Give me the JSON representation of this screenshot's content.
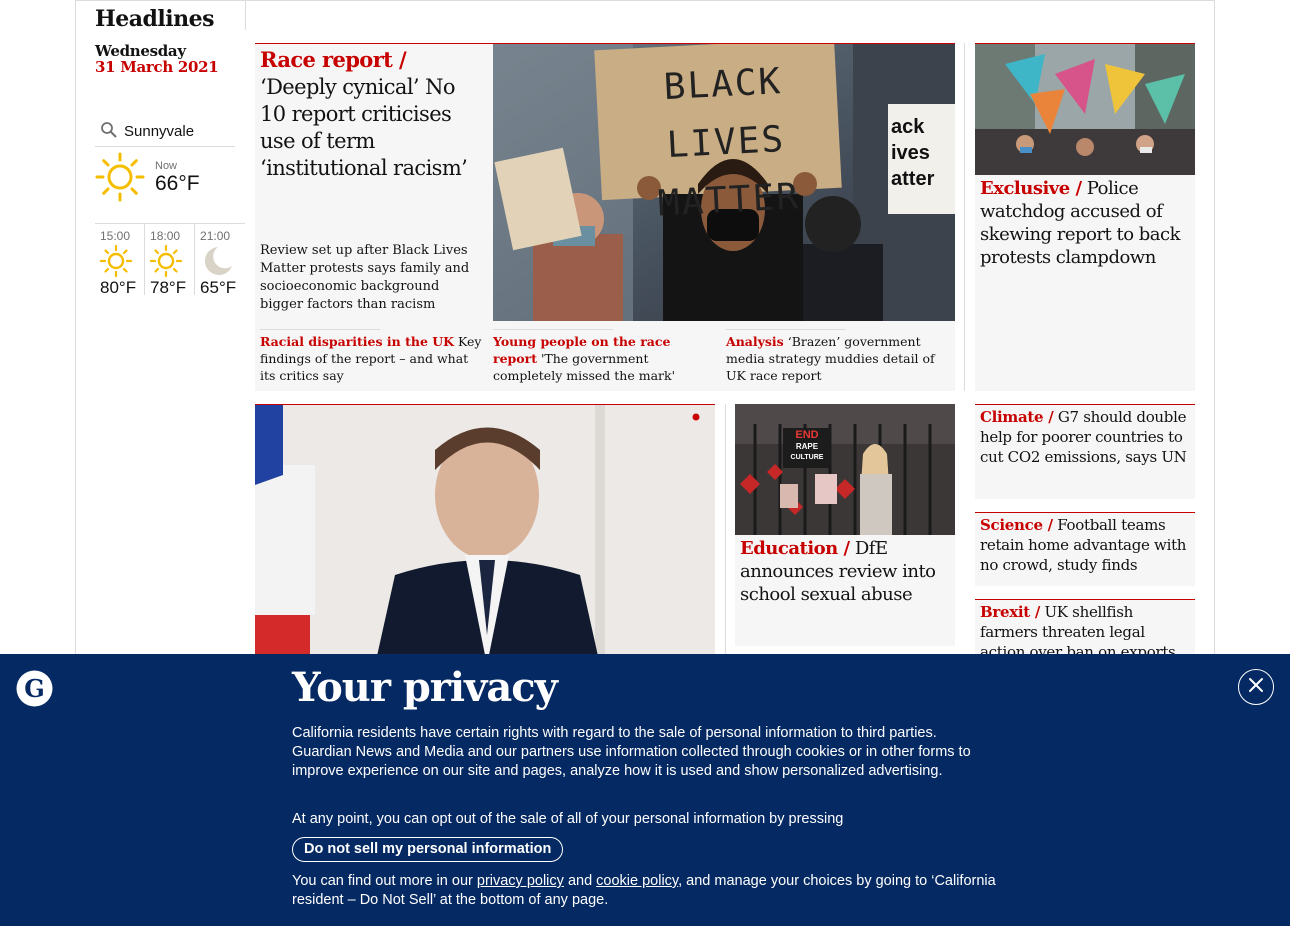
{
  "sidebar": {
    "section_title": "Headlines",
    "day": "Wednesday",
    "date": "31 March 2021",
    "weather": {
      "location": "Sunnyvale",
      "now_label": "Now",
      "now_temp": "66°F",
      "now_icon": "sun-icon",
      "forecast": [
        {
          "time": "15:00",
          "temp": "80°F",
          "icon": "sun-icon"
        },
        {
          "time": "18:00",
          "temp": "78°F",
          "icon": "sun-icon"
        },
        {
          "time": "21:00",
          "temp": "65°F",
          "icon": "moon-icon"
        }
      ]
    }
  },
  "lead": {
    "kicker": "Race report /",
    "headline": "‘Deeply cynical’ No 10 report criticises use of term ‘institutional racism’",
    "standfirst": "Review set up after Black Lives Matter protests says family and socioeconomic background bigger factors than racism",
    "image_sign_text": [
      "BLACK LIVES",
      "MATTER"
    ],
    "image_sign2_text": [
      "ack",
      "ives",
      "atter"
    ],
    "sublinks": [
      {
        "kicker": "Racial disparities in the UK",
        "text": "Key findings of the report – and what its critics say"
      },
      {
        "kicker": "Young people on the race report",
        "text": "'The government completely missed the mark'"
      },
      {
        "kicker": "Analysis",
        "text": "‘Brazen’ government media strategy muddies detail of UK race report"
      }
    ]
  },
  "side_top": {
    "kicker": "Exclusive /",
    "headline": "Police watchdog accused of skewing report to back protests clampdown"
  },
  "education": {
    "kicker": "Education /",
    "headline": "DfE announces review into school sexual abuse",
    "image_sign_text": [
      "END",
      "RAPE",
      "CULTURE"
    ]
  },
  "small_stories": [
    {
      "kicker": "Climate /",
      "headline": "G7 should double help for poorer countries to cut CO2 emissions, says UN"
    },
    {
      "kicker": "Science /",
      "headline": "Football teams retain home advantage with no crowd, study finds"
    },
    {
      "kicker": "Brexit /",
      "headline": "UK shellfish farmers threaten legal action over ban on exports"
    }
  ],
  "privacy": {
    "title": "Your privacy",
    "p1": "California residents have certain rights with regard to the sale of personal information to third parties. Guardian News and Media and our partners use information collected through cookies or in other forms to improve experience on our site and pages, analyze how it is used and show personalized advertising.",
    "p2": "At any point, you can opt out of the sale of all of your personal information by pressing",
    "button": "Do not sell my personal information",
    "p3_before": "You can find out more in our",
    "privacy_link": "privacy policy",
    "and": "and",
    "cookie_link": "cookie policy",
    "p3_after": ", and manage your choices by going to ‘California resident – Do Not Sell’ at the bottom of any page.",
    "logo_letter": "G"
  },
  "colors": {
    "accent_red": "#c70000",
    "banner_blue": "#052962",
    "card_bg": "#f6f6f6"
  }
}
